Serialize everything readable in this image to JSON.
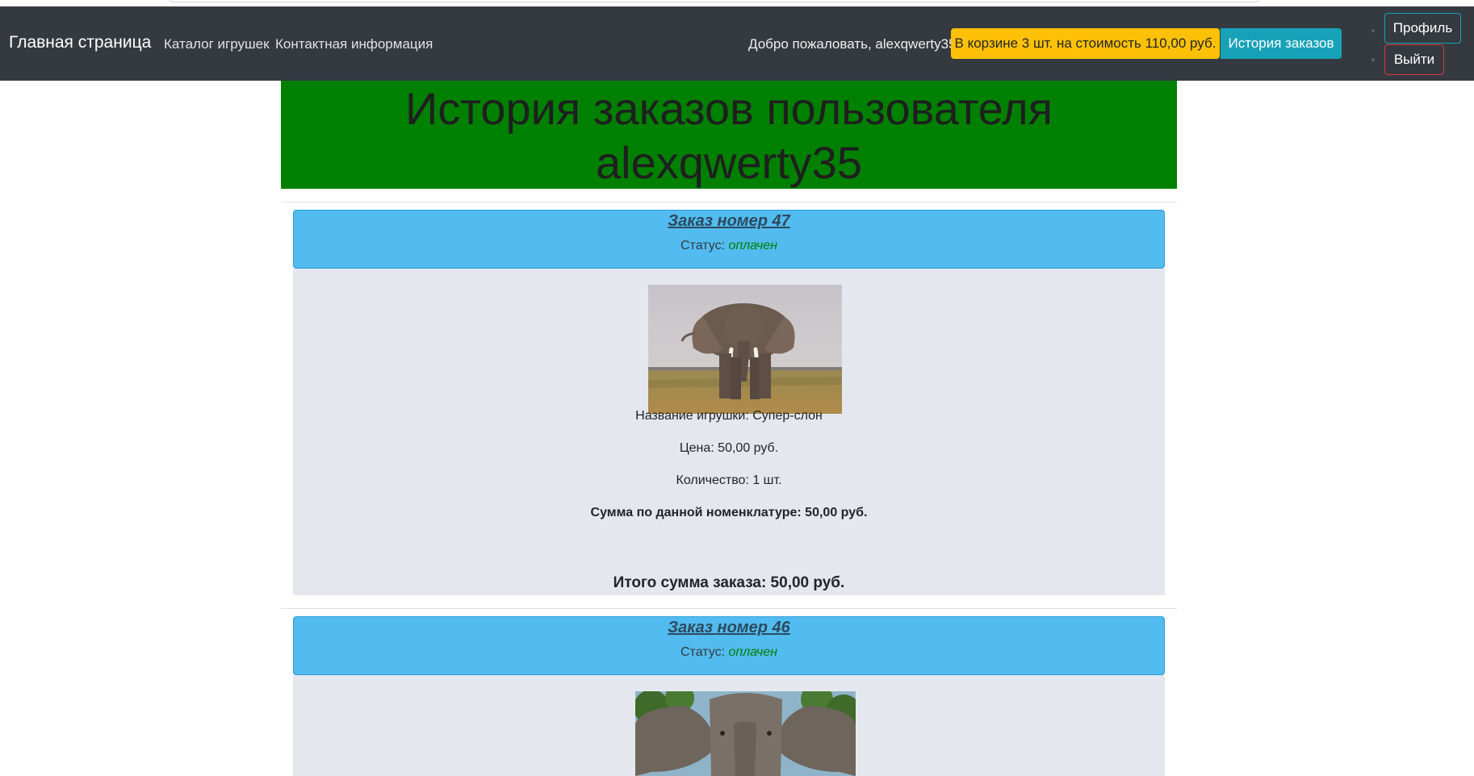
{
  "navbar": {
    "brand": "Главная страница",
    "links": [
      "Каталог игрушек",
      "Контактная информация"
    ],
    "welcome": "Добро пожаловать, alexqwerty35 .",
    "cart_button": "В корзине 3 шт. на стоимость 110,00 руб.",
    "history_button": "История заказов",
    "profile_button": "Профиль",
    "logout_button": "Выйти"
  },
  "page": {
    "title_line1": "История заказов пользователя",
    "title_line2": "alexqwerty35"
  },
  "orders": [
    {
      "title": "Заказ номер 47",
      "status_label": "Статус: ",
      "status": "оплачен",
      "items": [
        {
          "image": "elephant-savanna-photo",
          "name": "Название игрушки: Супер-слон",
          "price": "Цена: 50,00 руб.",
          "quantity": "Количество: 1 шт.",
          "subtotal": "Сумма по данной номенклатуре: 50,00 руб."
        }
      ],
      "total": "Итого сумма заказа: 50,00 руб."
    },
    {
      "title": "Заказ номер 46",
      "status_label": "Статус: ",
      "status": "оплачен",
      "items": [
        {
          "image": "elephant-closeup-photo"
        }
      ]
    }
  ],
  "colors": {
    "navbar": "#343a40",
    "header_bg": "#008000",
    "order_header": "#52bbf0",
    "order_body": "#e4e8ee",
    "status": "#008000",
    "cart_button": "#ffc107",
    "history_button": "#17a2b8",
    "logout_border": "#dc3545"
  }
}
